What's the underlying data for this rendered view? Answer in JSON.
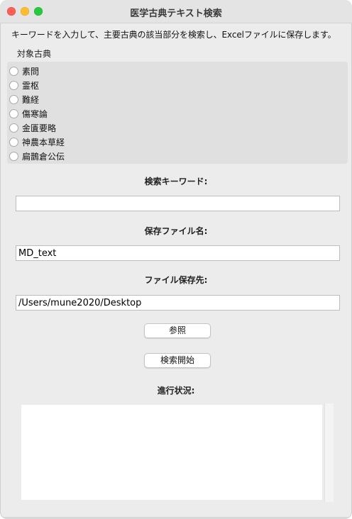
{
  "window": {
    "title": "医学古典テキスト検索"
  },
  "description": "キーワードを入力して、主要古典の該当部分を検索し、Excelファイルに保存します。",
  "classics": {
    "label": "対象古典",
    "options": [
      "素問",
      "霊枢",
      "難経",
      "傷寒論",
      "金匱要略",
      "神農本草経",
      "扁鵲倉公伝"
    ],
    "selected_index": -1
  },
  "keyword": {
    "label": "検索キーワード:",
    "value": ""
  },
  "save_filename": {
    "label": "保存ファイル名:",
    "value": "MD_text"
  },
  "save_location": {
    "label": "ファイル保存先:",
    "value": "/Users/mune2020/Desktop",
    "browse_label": "参照"
  },
  "search": {
    "start_label": "検索開始"
  },
  "progress": {
    "label": "進行状況:",
    "text": ""
  },
  "colors": {
    "window_bg": "#ececec",
    "radio_panel_bg": "#e0e0e0",
    "close": "#fe5f57",
    "minimize": "#febc2e",
    "maximize": "#28c840"
  }
}
